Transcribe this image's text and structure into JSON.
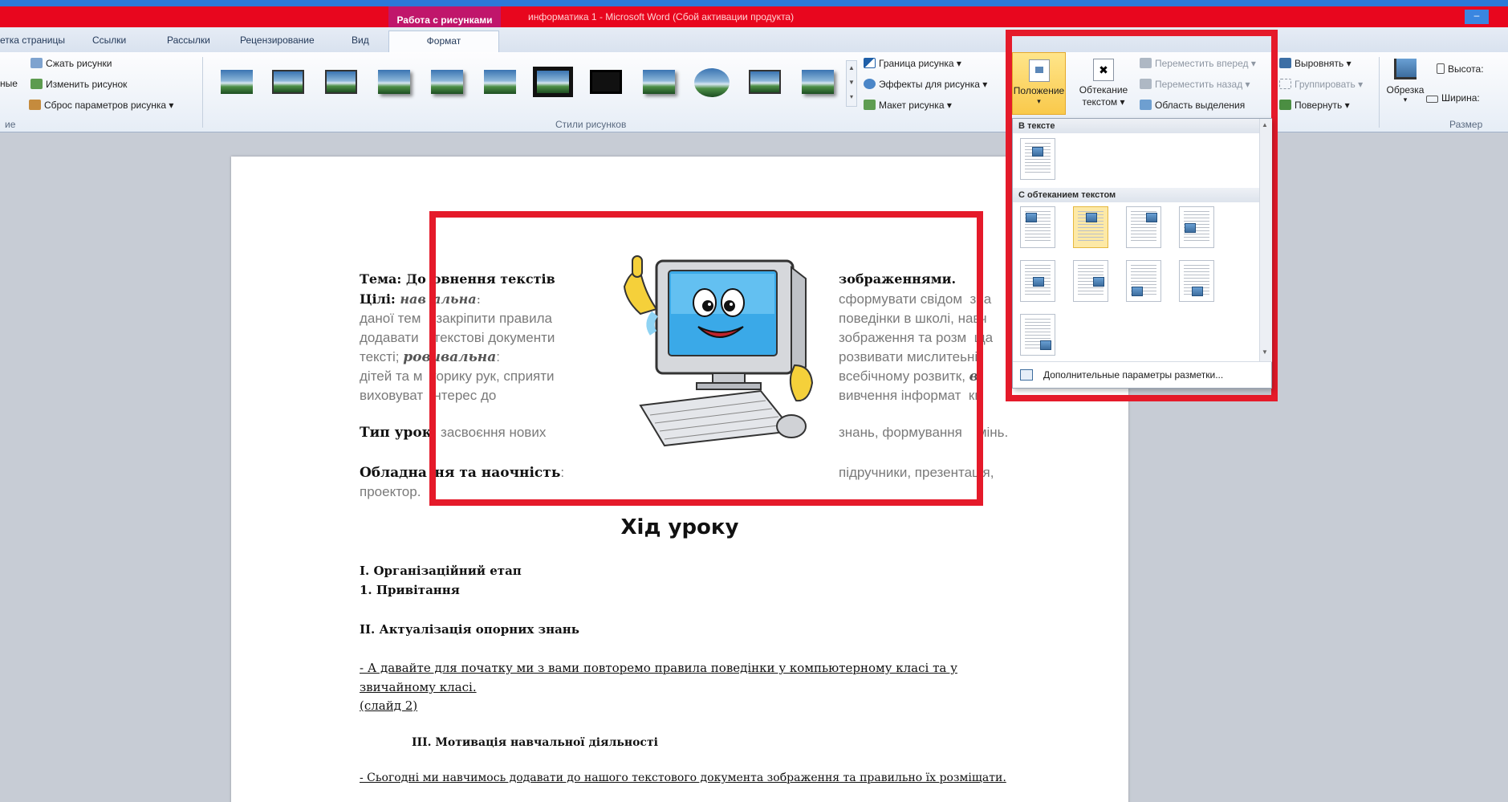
{
  "window": {
    "title": "информатика 1  -  Microsoft Word (Сбой активации продукта)",
    "context_tab_header": "Работа с рисунками",
    "minimize_glyph": "–"
  },
  "tabs": [
    {
      "label": "етка страницы"
    },
    {
      "label": "Ссылки"
    },
    {
      "label": "Рассылки"
    },
    {
      "label": "Рецензирование"
    },
    {
      "label": "Вид"
    },
    {
      "label": "Формат"
    }
  ],
  "ribbon": {
    "adjust": {
      "compress": "Сжать рисунки",
      "change": "Изменить рисунок",
      "reset": "Сброс параметров рисунка",
      "reset_arrow": "▾",
      "left_fragment": "ные",
      "group_label_fragment": "ие"
    },
    "picture_styles": {
      "group_label": "Стили рисунков",
      "border": "Граница рисунка",
      "effects": "Эффекты для рисунка",
      "layout": "Макет рисунка",
      "dropdown_arrow": "▾"
    },
    "arrange": {
      "position": "Положение",
      "wrap_line1": "Обтекание",
      "wrap_line2": "текстом",
      "bring_forward": "Переместить вперед",
      "send_backward": "Переместить назад",
      "selection_pane": "Область выделения",
      "align": "Выровнять",
      "group": "Группировать",
      "rotate": "Повернуть"
    },
    "size": {
      "crop": "Обрезка",
      "height": "Высота:",
      "width": "Ширина:",
      "group_label": "Размер"
    }
  },
  "position_menu": {
    "in_text_header": "В тексте",
    "wrap_header": "С обтеканием текстом",
    "more_options": "Дополнительные параметры разметки..."
  },
  "document": {
    "topic_label": "Тема:",
    "topic_a": "До",
    "topic_b": "овнення текстів",
    "topic_c": "зображеннями.",
    "goals_label": "Цілі:",
    "goals_a": "нав",
    "goals_b": "альна",
    "goals_c": ":",
    "col_right_1": "сформувати свідом",
    "col_right_1b": "зна",
    "l3a": "даної тем",
    "l3b": ", закріпити правила",
    "l3c": "поведінки в школі, н",
    "l3d": "авч",
    "l4a": "додавати",
    "l4b": "текстові документи",
    "l4c": "зображення та розм",
    "l4d": "ща",
    "l5a": "тексті;",
    "l5b": "ро",
    "l5c": "вивальна",
    "l5d": ":",
    "l5e": "розвивати мислите",
    "l5f": "ьні",
    "l6a": "дітей та м",
    "l6b": "торику рук, сприяти",
    "l6c": "всебічному розвитк",
    "l6d": ",",
    "l6e": "в",
    "l7a": "виховуват",
    "l7b": "інтерес до",
    "l7c": "вивчення інформат",
    "l7d": "ки",
    "type_label": "Тип урок",
    "type_label_b": ":",
    "type_a": "засвоєння нових",
    "type_b": "знань, формування",
    "type_c": "мінь.",
    "equip_label": "Обладна",
    "equip_label_b": "ня та наочність",
    "equip_c": ":",
    "equip_d": "підручники, презент",
    "equip_e": "ація,",
    "projector": "проектор.",
    "heading": "Хід уроку",
    "s1": "І. Організаційний етап",
    "s1_1": "1. Привітання",
    "s2": "ІІ. Актуалізація опорних знань",
    "p1": "- А давайте для початку ми з вами  повторемо правила поведінки у компьютерному класі та у",
    "p1b": "звичайному класі.",
    "slide": "(слайд 2)",
    "s3": "ІІІ. Мотивація навчальної діяльності",
    "p2": "- Сьогодні ми навчимось  додавати  до нашого  текстового  документа  зображення  та  правильно  їх розміщати."
  },
  "colors": {
    "title_bar": "#e8061e",
    "context_tab": "#c0166b",
    "highlight_box": "#e51a2a",
    "selected_option": "#fde9a6"
  },
  "icons": [
    "compress-pictures-icon",
    "change-picture-icon",
    "reset-picture-icon",
    "picture-border-icon",
    "picture-effects-icon",
    "picture-layout-icon",
    "position-icon",
    "wrap-text-icon",
    "bring-forward-icon",
    "send-backward-icon",
    "selection-pane-icon",
    "align-icon",
    "group-icon",
    "rotate-icon",
    "crop-icon",
    "height-icon",
    "width-icon",
    "layout-options-icon",
    "minimize-icon"
  ]
}
